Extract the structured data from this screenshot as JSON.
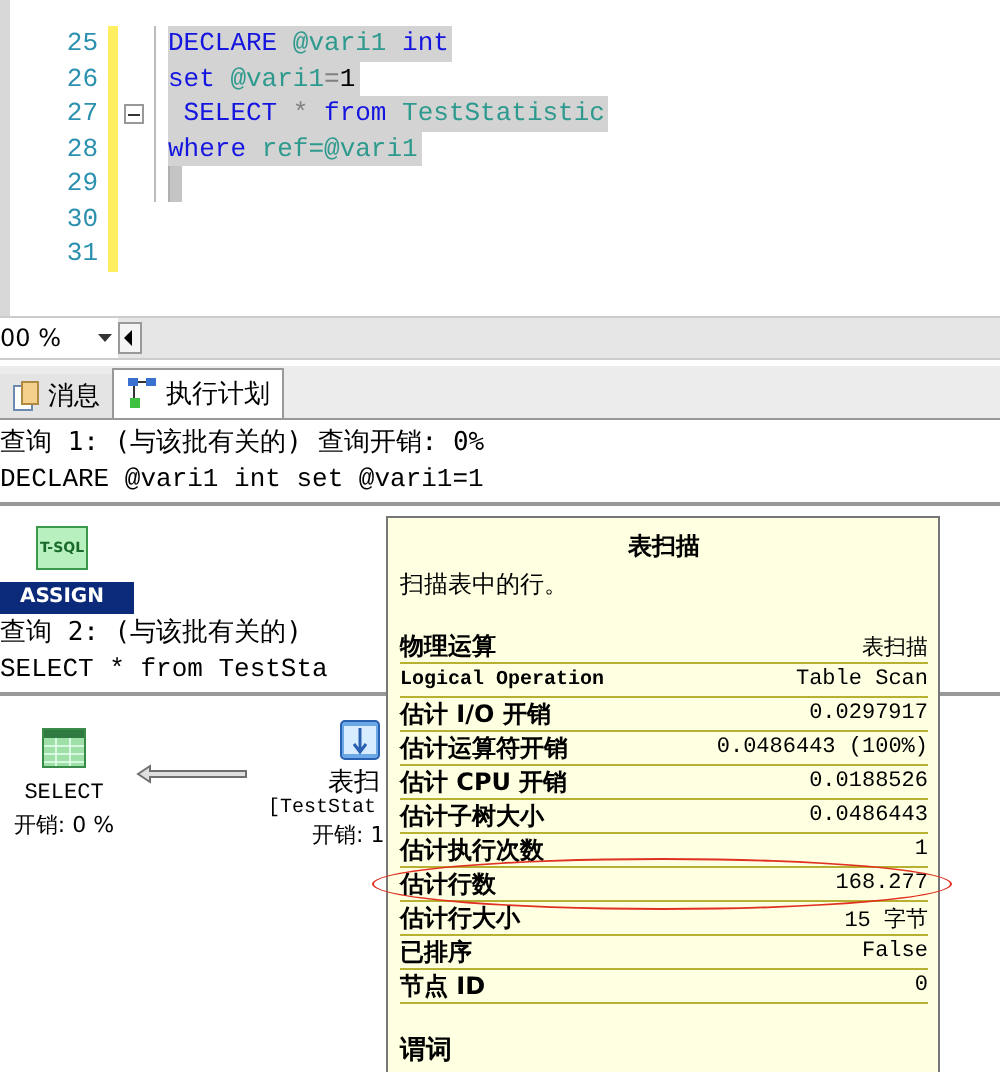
{
  "editor": {
    "lines": [
      {
        "number": "25",
        "selected": true,
        "tokens": [
          {
            "text": "DECLARE",
            "kind": "keyword"
          },
          {
            "text": " @vari1",
            "kind": "ident"
          },
          {
            "text": " int",
            "kind": "keyword"
          }
        ]
      },
      {
        "number": "26",
        "selected": true,
        "tokens": [
          {
            "text": "set",
            "kind": "keyword"
          },
          {
            "text": " @vari1",
            "kind": "ident"
          },
          {
            "text": "=",
            "kind": "operator"
          },
          {
            "text": "1",
            "kind": "plain"
          }
        ]
      },
      {
        "number": "27",
        "selected": true,
        "fold": true,
        "tokens": [
          {
            "text": " SELECT",
            "kind": "keyword"
          },
          {
            "text": " *",
            "kind": "operator"
          },
          {
            "text": " from",
            "kind": "keyword"
          },
          {
            "text": " TestStatistic",
            "kind": "ident"
          }
        ]
      },
      {
        "number": "28",
        "selected": true,
        "tokens": [
          {
            "text": "where",
            "kind": "keyword"
          },
          {
            "text": " ref=@vari1",
            "kind": "ident"
          }
        ]
      },
      {
        "number": "29",
        "selected": true
      },
      {
        "number": "30",
        "selected": false
      },
      {
        "number": "31",
        "selected": false
      }
    ]
  },
  "zoom": {
    "value": "00 %"
  },
  "tabs": [
    {
      "label": "消息",
      "kind": "messages",
      "selected": false
    },
    {
      "label": "执行计划",
      "kind": "plan",
      "selected": true
    }
  ],
  "queries": [
    {
      "header": "查询 1: (与该批有关的) 查询开销: 0%",
      "sql": "DECLARE @vari1 int set @vari1=1",
      "nodes": [
        {
          "kind": "tsql",
          "icon_label": "T-SQL",
          "banner": "ASSIGN"
        }
      ]
    },
    {
      "header": "查询 2: (与该批有关的)",
      "sql": "SELECT * from TestSta",
      "nodes": [
        {
          "kind": "select",
          "lines": [
            "SELECT",
            "开销: 0 %"
          ]
        },
        {
          "kind": "scan",
          "lines": [
            "表扫",
            "[TestStat",
            "开销: 1"
          ]
        }
      ]
    }
  ],
  "tooltip": {
    "title": "表扫描",
    "description": "扫描表中的行。",
    "rows": [
      {
        "label": "物理运算",
        "value": "表扫描",
        "circled": false
      },
      {
        "label": "Logical Operation",
        "value": "Table Scan",
        "circled": false
      },
      {
        "label": "估计 I/O 开销",
        "value": "0.0297917",
        "circled": false
      },
      {
        "label": "估计运算符开销",
        "value": "0.0486443 (100%)",
        "circled": false
      },
      {
        "label": "估计 CPU 开销",
        "value": "0.0188526",
        "circled": false
      },
      {
        "label": "估计子树大小",
        "value": "0.0486443",
        "circled": false
      },
      {
        "label": "估计执行次数",
        "value": "1",
        "circled": false
      },
      {
        "label": "估计行数",
        "value": "168.277",
        "circled": true
      },
      {
        "label": "估计行大小",
        "value": "15 字节",
        "circled": false
      },
      {
        "label": "已排序",
        "value": "False",
        "circled": false
      },
      {
        "label": "节点 ID",
        "value": "0",
        "circled": false
      }
    ],
    "section": "谓词"
  }
}
